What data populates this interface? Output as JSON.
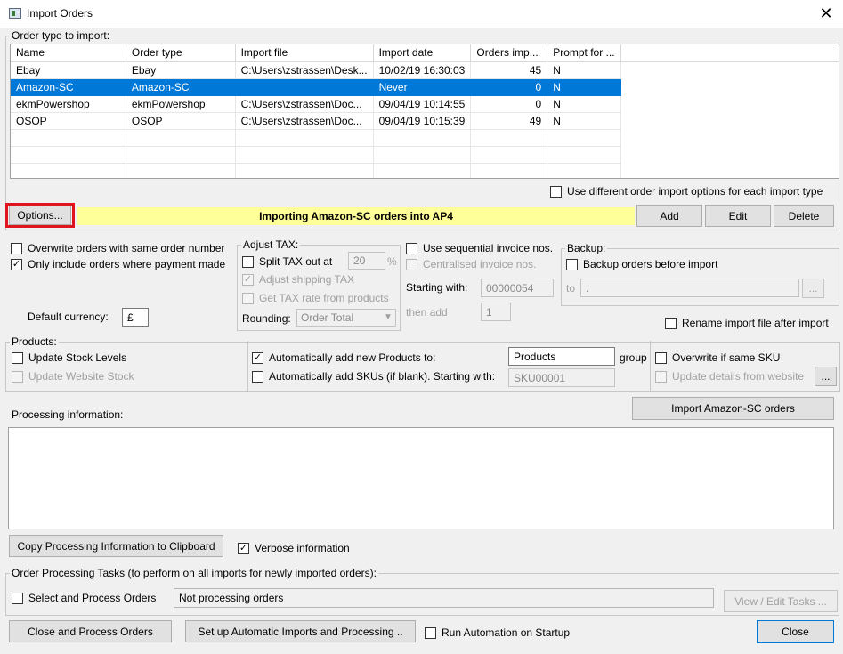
{
  "window": {
    "title": "Import Orders",
    "close_glyph": "✕"
  },
  "order_types": {
    "legend": "Order type to import:",
    "columns": [
      "Name",
      "Order type",
      "Import file",
      "Import date",
      "Orders imp...",
      "Prompt for ..."
    ],
    "rows": [
      {
        "name": "Ebay",
        "type": "Ebay",
        "file": "C:\\Users\\zstrassen\\Desk...",
        "date": "10/02/19 16:30:03",
        "orders": "45",
        "prompt": "N"
      },
      {
        "name": "Amazon-SC",
        "type": "Amazon-SC",
        "file": "",
        "date": "Never",
        "orders": "0",
        "prompt": "N"
      },
      {
        "name": "ekmPowershop",
        "type": "ekmPowershop",
        "file": "C:\\Users\\zstrassen\\Doc...",
        "date": "09/04/19 10:14:55",
        "orders": "0",
        "prompt": "N"
      },
      {
        "name": "OSOP",
        "type": "OSOP",
        "file": "C:\\Users\\zstrassen\\Doc...",
        "date": "09/04/19 10:15:39",
        "orders": "49",
        "prompt": "N"
      }
    ],
    "selected_index": 1,
    "use_different_label": "Use different order import options for each import type",
    "options_label": "Options...",
    "banner_text": "Importing Amazon-SC orders into AP4",
    "add_label": "Add",
    "edit_label": "Edit",
    "delete_label": "Delete"
  },
  "general": {
    "overwrite_label": "Overwrite orders with same order number",
    "only_paid_label": "Only include orders where payment made",
    "default_currency_label": "Default currency:",
    "default_currency_value": "£"
  },
  "tax": {
    "legend": "Adjust TAX:",
    "split_label": "Split TAX out at",
    "split_value": "20",
    "percent": "%",
    "adjust_shipping_label": "Adjust shipping TAX",
    "get_rate_label": "Get TAX rate from products",
    "rounding_label": "Rounding:",
    "rounding_value": "Order Total"
  },
  "invoice": {
    "sequential_label": "Use sequential invoice nos.",
    "centralised_label": "Centralised invoice nos.",
    "starting_with_label": "Starting with:",
    "starting_with_value": "00000054",
    "then_add_label": "then add",
    "then_add_value": "1"
  },
  "backup": {
    "legend": "Backup:",
    "backup_label": "Backup orders before import",
    "to_label": "to",
    "to_value": ".",
    "browse_label": "..."
  },
  "rename_label": "Rename import file after import",
  "products": {
    "legend": "Products:",
    "update_stock_label": "Update Stock Levels",
    "update_website_stock_label": "Update Website Stock",
    "auto_add_products_label": "Automatically add new Products to:",
    "products_group_value": "Products",
    "group_label": "group",
    "auto_add_skus_label": "Automatically add SKUs (if blank). Starting with:",
    "sku_start_value": "SKU00001",
    "overwrite_sku_label": "Overwrite if same SKU",
    "update_details_label": "Update details from website",
    "details_browse_label": "..."
  },
  "processing": {
    "label": "Processing information:",
    "import_button_label": "Import Amazon-SC orders",
    "text": "",
    "copy_button_label": "Copy Processing Information to Clipboard",
    "verbose_label": "Verbose information"
  },
  "tasks": {
    "legend": "Order Processing Tasks (to perform on all imports for newly imported orders):",
    "select_process_label": "Select and Process Orders",
    "status_value": "Not processing orders",
    "view_edit_label": "View / Edit Tasks ..."
  },
  "footer": {
    "close_process_label": "Close and Process Orders",
    "setup_auto_label": "Set up Automatic Imports and Processing ..",
    "run_automation_label": "Run Automation on Startup",
    "close_label": "Close"
  },
  "check_glyph": "✓",
  "colors": {
    "selection": "#0078d7",
    "banner": "#ffff99",
    "highlight_frame": "#e0141e"
  }
}
